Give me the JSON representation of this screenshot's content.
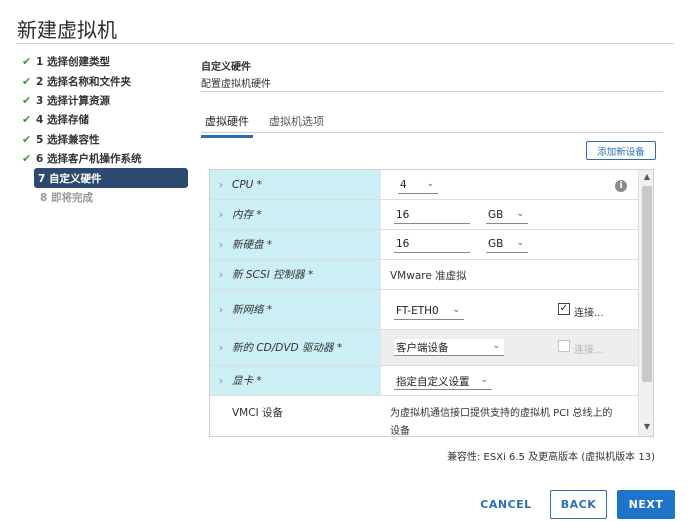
{
  "window": {
    "title": "新建虚拟机"
  },
  "steps": [
    {
      "label": "1 选择创建类型",
      "state": "done"
    },
    {
      "label": "2 选择名称和文件夹",
      "state": "done"
    },
    {
      "label": "3 选择计算资源",
      "state": "done"
    },
    {
      "label": "4 选择存储",
      "state": "done"
    },
    {
      "label": "5 选择兼容性",
      "state": "done"
    },
    {
      "label": "6 选择客户机操作系统",
      "state": "done"
    },
    {
      "label": "7 自定义硬件",
      "state": "active"
    },
    {
      "label": "8 即将完成",
      "state": "future"
    }
  ],
  "check_glyph": "✔",
  "section": {
    "title": "自定义硬件",
    "subtitle": "配置虚拟机硬件"
  },
  "tabs": [
    {
      "label": "虚拟硬件",
      "active": true
    },
    {
      "label": "虚拟机选项",
      "active": false
    }
  ],
  "add_device_label": "添加新设备",
  "hardware": {
    "cpu": {
      "label": "CPU *",
      "value": "4"
    },
    "memory": {
      "label": "内存 *",
      "value": "16",
      "unit": "GB"
    },
    "disk": {
      "label": "新硬盘 *",
      "value": "16",
      "unit": "GB"
    },
    "scsi": {
      "label": "新 SCSI 控制器 *",
      "value": "VMware 准虚拟"
    },
    "network": {
      "label": "新网络 *",
      "value": "FT-ETH0",
      "connect_label": "连接...",
      "connected": true
    },
    "cdrom": {
      "label": "新的 CD/DVD 驱动器 *",
      "value": "客户端设备",
      "connect_label": "连接...",
      "connected": false
    },
    "video": {
      "label": "显卡 *",
      "value": "指定自定义设置"
    },
    "vmci": {
      "label": "VMCI 设备",
      "line1": "为虚拟机通信接口提供支持的虚拟机 PCI 总线上的",
      "line2": "设备"
    }
  },
  "compatibility": "兼容性: ESXi 6.5 及更高版本 (虚拟机版本 13)",
  "buttons": {
    "cancel": "CANCEL",
    "back": "BACK",
    "next": "NEXT"
  },
  "colors": {
    "accent": "#1e74c8",
    "active_step": "#2c4a6f",
    "row_label_bg": "#cbeff4",
    "check_green": "#3c9a3c"
  }
}
